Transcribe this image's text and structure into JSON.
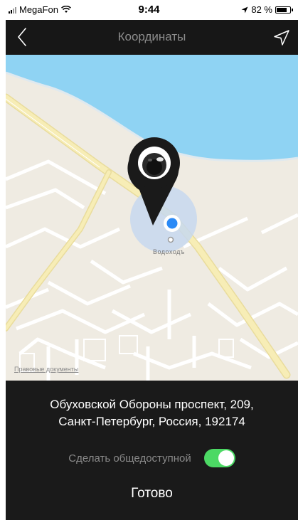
{
  "status_bar": {
    "carrier": "MegaFon",
    "time": "9:44",
    "battery": "82 %",
    "battery_level": 0.82
  },
  "nav": {
    "title": "Координаты",
    "back_icon": "chevron-left-icon",
    "action_icon": "location-arrow-icon"
  },
  "map": {
    "poi_label": "Водоходъ",
    "legal_link": "Правовые документы",
    "colors": {
      "water": "#8fd3f3",
      "land": "#efebe2",
      "road_main": "#f5e7a3",
      "road_minor": "#ffffff",
      "accuracy_circle": "#c7d8ee",
      "user_dot": "#2b8af6",
      "pin": "#1a1a1a"
    }
  },
  "panel": {
    "address_line1": "Обуховской Обороны проспект, 209,",
    "address_line2": "Санкт-Петербург, Россия, 192174",
    "toggle_label": "Сделать общедоступной",
    "toggle_on": true,
    "done_label": "Готово",
    "toggle_color": "#4cd964"
  }
}
